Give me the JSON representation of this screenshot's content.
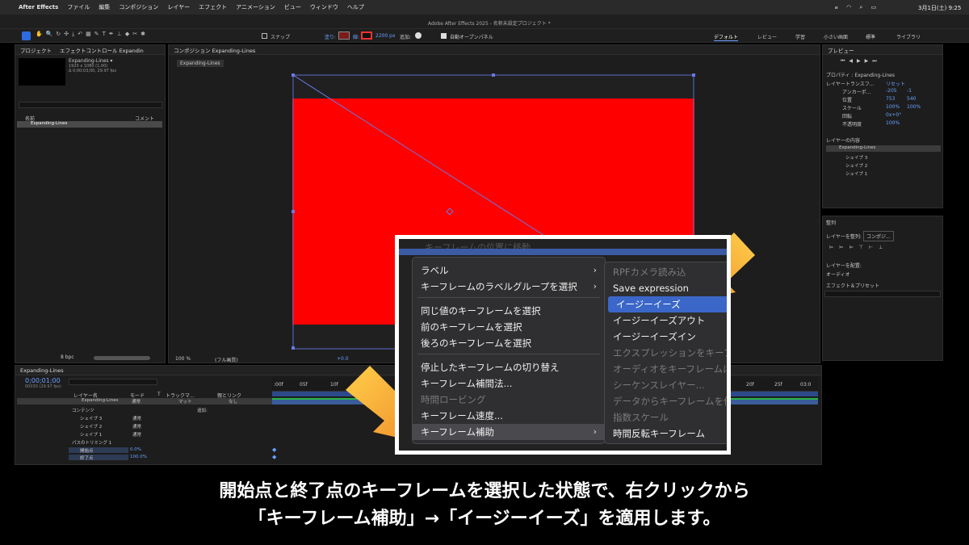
{
  "menubar": {
    "apple": "",
    "items": [
      "After Effects",
      "ファイル",
      "編集",
      "コンポジション",
      "レイヤー",
      "エフェクト",
      "アニメーション",
      "ビュー",
      "ウィンドウ",
      "ヘルプ"
    ],
    "window_title": "Adobe After Effects 2025 - 名称未設定プロジェクト *",
    "clock": "3月1日(土) 9:25"
  },
  "toolbar": {
    "snap_label": "スナップ",
    "fill_label": "塗り:",
    "stroke_label": "線:",
    "stroke_value": "2200 px",
    "add_label": "追加:",
    "auto_open_label": "自動オープンパネル",
    "workspaces": [
      "デフォルト",
      "レビュー",
      "学習",
      "小さい画面",
      "標準",
      "ライブラリ"
    ]
  },
  "project_panel": {
    "tab_project": "プロジェクト",
    "tab_effects": "エフェクトコントロール Expandin",
    "item_name": "Expanding-Lines ▾",
    "item_info1": "1920 x 1080 (1.00)",
    "item_info2": "Δ 0;00;03;00, 29.97 fps",
    "col_name": "名前",
    "col_comment": "コメント",
    "row_name": "Expanding-Lines",
    "bpc": "8 bpc"
  },
  "comp_panel": {
    "tab": "コンポジション Expanding-Lines",
    "sub_tab": "Expanding-Lines",
    "zoom": "100 %",
    "quality": "(フル画質)",
    "exposure": "+0.0"
  },
  "right_panel": {
    "preview_title": "プレビュー",
    "properties_title": "プロパティ : Expanding-Lines",
    "layer_transform": "レイヤートランスフ...",
    "reset": "リセット",
    "props": [
      {
        "name": "アンカーポ...",
        "v1": "-205",
        "v2": "-1"
      },
      {
        "name": "位置",
        "v1": "753",
        "v2": "540"
      },
      {
        "name": "スケール",
        "v1": "100%",
        "v2": "100%"
      },
      {
        "name": "回転",
        "v1": "0x+0°",
        "v2": ""
      },
      {
        "name": "不透明度",
        "v1": "100%",
        "v2": ""
      }
    ],
    "layer_contents_title": "レイヤーの内容",
    "layer_tree": [
      "Expanding-Lines",
      "シェイプ 3",
      "シェイプ 2",
      "シェイプ 1"
    ],
    "align_title": "整列",
    "align_to_label": "レイヤーを整列:",
    "align_to_value": "コンポジ...",
    "distribute_label": "レイヤーを配置:",
    "audio_title": "オーディオ",
    "effects_title": "エフェクト＆プリセット"
  },
  "timeline": {
    "tab": "Expanding-Lines",
    "timecode": "0;00;01;00",
    "frames": "00030 (29.97 fps)",
    "col_layer_name": "レイヤー名",
    "col_mode": "モード",
    "col_t": "T",
    "col_trackmatte": "トラックマ...",
    "col_parent": "親とリンク",
    "layer_row_name": "Expanding-Lines",
    "layer_row_mode": "通常",
    "layer_row_matte": "マット",
    "layer_row_parent": "なし",
    "contents_label": "コンテンツ",
    "add_label": "追加:",
    "shapes": [
      {
        "name": "シェイプ 3",
        "mode": "通常"
      },
      {
        "name": "シェイプ 2",
        "mode": "通常"
      },
      {
        "name": "シェイプ 1",
        "mode": "通常"
      }
    ],
    "trim_paths": "パスのトリミング 1",
    "start_label": "開始点",
    "start_value": "0.0%",
    "end_label": "終了点",
    "end_value": "100.0%",
    "ruler": [
      ":00f",
      "05f",
      "10f",
      "20f",
      "25f",
      "03:0"
    ]
  },
  "context_menu": {
    "top_cut": "キーフレームの位置に移動",
    "items": [
      {
        "label": "ラベル",
        "submenu": true
      },
      {
        "label": "キーフレームのラベルグループを選択",
        "submenu": true
      },
      {
        "label": "同じ値のキーフレームを選択"
      },
      {
        "label": "前のキーフレームを選択"
      },
      {
        "label": "後ろのキーフレームを選択"
      },
      {
        "label": "停止したキーフレームの切り替え"
      },
      {
        "label": "キーフレーム補間法..."
      },
      {
        "label": "時間ロービング",
        "disabled": true
      },
      {
        "label": "キーフレーム速度..."
      },
      {
        "label": "キーフレーム補助",
        "submenu": true
      }
    ]
  },
  "sub_menu": {
    "items": [
      {
        "label": "RPFカメラ読み込",
        "disabled": true
      },
      {
        "label": "Save expression"
      },
      {
        "label": "イージーイーズ",
        "selected": true
      },
      {
        "label": "イージーイーズアウト"
      },
      {
        "label": "イージーイーズイン"
      },
      {
        "label": "エクスプレッションをキーフ",
        "disabled": true
      },
      {
        "label": "オーディオをキーフレームに",
        "disabled": true
      },
      {
        "label": "シーケンスレイヤー...",
        "disabled": true
      },
      {
        "label": "データからキーフレームを作",
        "disabled": true
      },
      {
        "label": "指数スケール",
        "disabled": true
      },
      {
        "label": "時間反転キーフレーム"
      }
    ]
  },
  "caption": {
    "line1": "開始点と終了点のキーフレームを選択した状態で、右クリックから",
    "line2": "「キーフレーム補助」→「イージーイーズ」を適用します。"
  },
  "colors": {
    "solid_red": "#ff0000",
    "arrow_orange": "#f5a623",
    "menu_highlight": "#3b67c9"
  }
}
